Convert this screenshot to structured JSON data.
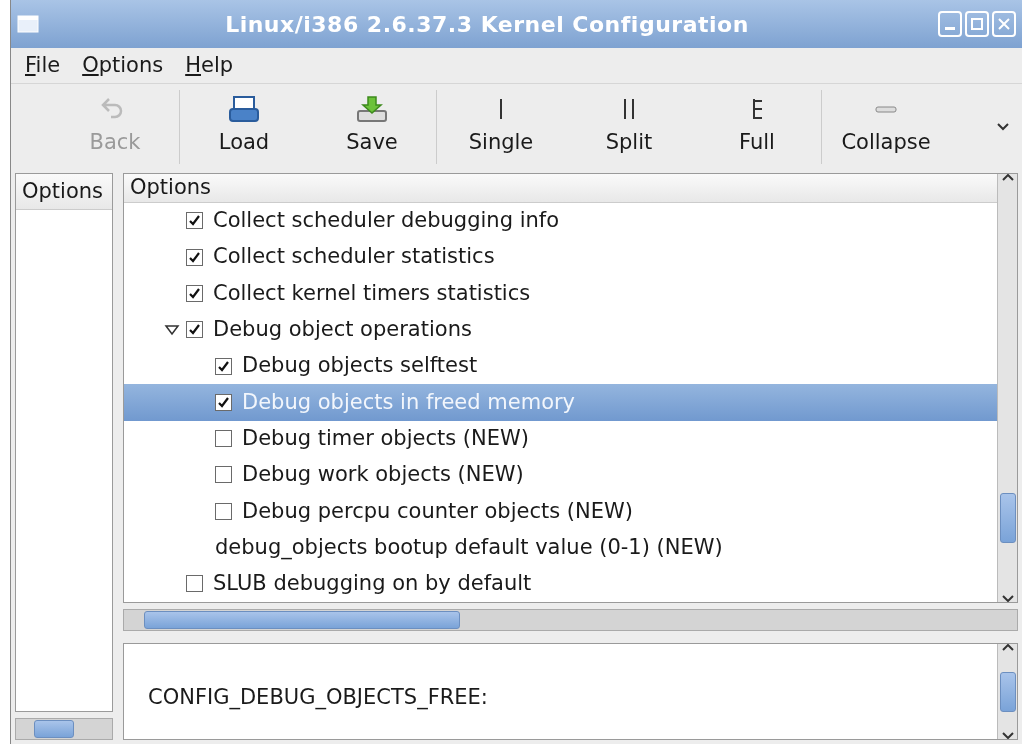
{
  "window": {
    "title": "Linux/i386 2.6.37.3 Kernel Configuration"
  },
  "menu": [
    "File",
    "Options",
    "Help"
  ],
  "toolbar": [
    {
      "label": "Back",
      "kind": "back",
      "disabled": true
    },
    {
      "label": "Load",
      "kind": "load",
      "disabled": false
    },
    {
      "label": "Save",
      "kind": "save",
      "disabled": false
    },
    {
      "label": "Single",
      "kind": "single",
      "disabled": false
    },
    {
      "label": "Split",
      "kind": "split",
      "disabled": false
    },
    {
      "label": "Full",
      "kind": "full",
      "disabled": false
    },
    {
      "label": "Collapse",
      "kind": "collapse",
      "disabled": false
    }
  ],
  "left_pane": {
    "header": "Options"
  },
  "tree": {
    "header": "Options",
    "items": [
      {
        "label": "Collect scheduler debugging info",
        "kind": "checkbox",
        "checked": true,
        "selected": false
      },
      {
        "label": "Collect scheduler statistics",
        "kind": "checkbox",
        "checked": true,
        "selected": false
      },
      {
        "label": "Collect kernel timers statistics",
        "kind": "checkbox",
        "checked": true,
        "selected": false
      },
      {
        "label": "Debug object operations",
        "kind": "checkbox",
        "checked": true,
        "selected": false,
        "expanded": true,
        "children": [
          {
            "label": "Debug objects selftest",
            "kind": "checkbox",
            "checked": true,
            "selected": false
          },
          {
            "label": "Debug objects in freed memory",
            "kind": "checkbox",
            "checked": true,
            "selected": true
          },
          {
            "label": "Debug timer objects (NEW)",
            "kind": "checkbox",
            "checked": false,
            "selected": false
          },
          {
            "label": "Debug work objects (NEW)",
            "kind": "checkbox",
            "checked": false,
            "selected": false
          },
          {
            "label": "Debug percpu counter objects (NEW)",
            "kind": "checkbox",
            "checked": false,
            "selected": false
          },
          {
            "label": "debug_objects bootup default value (0-1) (NEW)",
            "kind": "value",
            "selected": false
          }
        ]
      },
      {
        "label": "SLUB debugging on by default",
        "kind": "checkbox",
        "checked": false,
        "selected": false
      }
    ]
  },
  "help": {
    "symbol": "CONFIG_DEBUG_OBJECTS_FREE:"
  }
}
